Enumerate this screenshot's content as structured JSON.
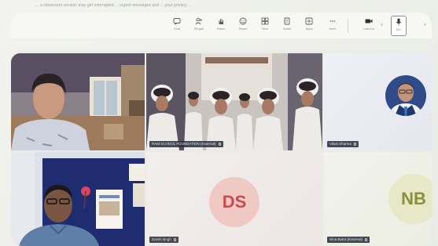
{
  "caption": "... a classroom session may get interrupted ... urgent messages and ... your privacy ... ",
  "toolbar": {
    "items": [
      {
        "label": "Chat",
        "icon": "chat-icon"
      },
      {
        "label": "People",
        "icon": "people-icon"
      },
      {
        "label": "Raise",
        "icon": "hand-icon"
      },
      {
        "label": "React",
        "icon": "smile-icon"
      },
      {
        "label": "View",
        "icon": "grid-icon"
      },
      {
        "label": "Notes",
        "icon": "notes-icon"
      },
      {
        "label": "Apps",
        "icon": "apps-icon"
      },
      {
        "label": "More",
        "icon": "more-icon"
      },
      {
        "label": "Camera",
        "icon": "camera-icon"
      },
      {
        "label": "Mic",
        "icon": "mic-icon"
      }
    ]
  },
  "participants": [
    {
      "name": "",
      "kind": "video",
      "scene": "woman-room"
    },
    {
      "name": "RAM SCHOOL FOUNDATION (External)",
      "kind": "video",
      "scene": "classroom"
    },
    {
      "name": "Vikas Sharma",
      "kind": "avatar",
      "scene": "portrait"
    },
    {
      "name": "",
      "kind": "video",
      "scene": "man-office"
    },
    {
      "name": "Darsh Singh",
      "kind": "initials",
      "initials": "DS",
      "color": "#c84b4e",
      "bg": "#f1c9c4"
    },
    {
      "name": "Nina Batra (External)",
      "kind": "initials",
      "initials": "NB",
      "color": "#8c8f3a",
      "bg": "#e6e8c8"
    }
  ]
}
